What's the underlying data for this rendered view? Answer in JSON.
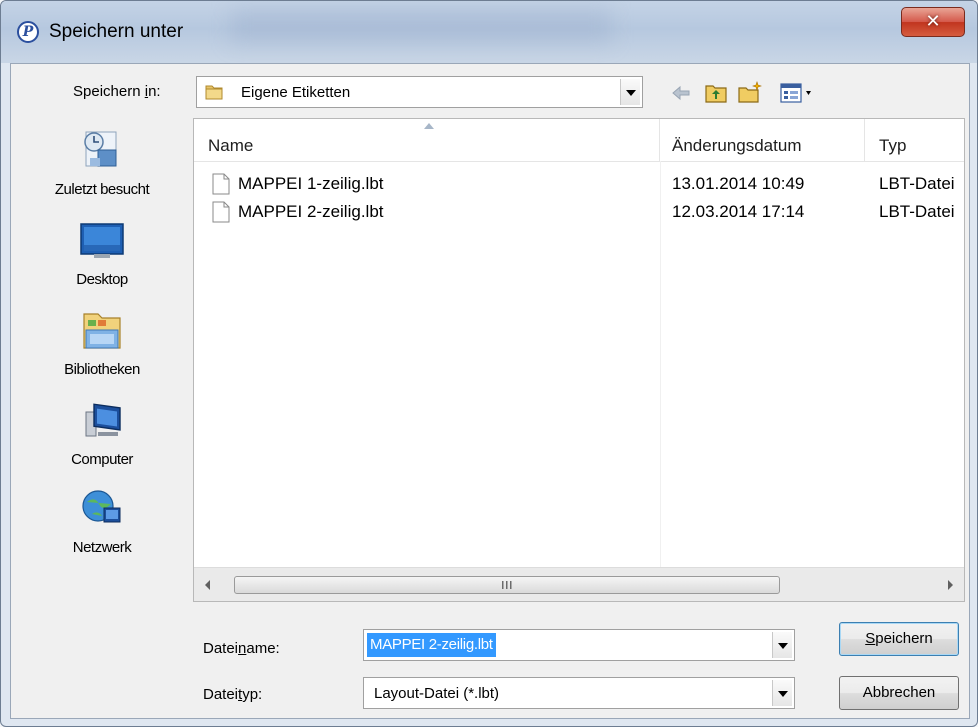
{
  "window": {
    "title": "Speichern unter"
  },
  "toolbar": {
    "save_in_label": "Speichern in:",
    "save_in_value": "Eigene Etiketten",
    "icons": [
      "back-arrow-icon",
      "up-folder-icon",
      "new-folder-icon",
      "views-menu-icon"
    ]
  },
  "places": [
    {
      "label": "Zuletzt besucht",
      "icon": "recent-places-icon"
    },
    {
      "label": "Desktop",
      "icon": "desktop-icon"
    },
    {
      "label": "Bibliotheken",
      "icon": "libraries-icon"
    },
    {
      "label": "Computer",
      "icon": "computer-icon"
    },
    {
      "label": "Netzwerk",
      "icon": "network-icon"
    }
  ],
  "columns": {
    "name": "Name",
    "date": "Änderungsdatum",
    "type": "Typ"
  },
  "files": [
    {
      "name": "MAPPEI 1-zeilig.lbt",
      "date": "13.01.2014 10:49",
      "type": "LBT-Datei"
    },
    {
      "name": "MAPPEI 2-zeilig.lbt",
      "date": "12.03.2014 17:14",
      "type": "LBT-Datei"
    }
  ],
  "scrollbar": {
    "grip": "III"
  },
  "form": {
    "filename_label": "Dateiname:",
    "filename_value": "MAPPEI 2-zeilig.lbt",
    "filetype_label": "Dateityp:",
    "filetype_value": "Layout-Datei (*.lbt)"
  },
  "buttons": {
    "save": "Speichern",
    "cancel": "Abbrechen"
  },
  "colors": {
    "selection": "#3399ff",
    "close_button": "#c7402b",
    "titlebar": "#b9cbe1"
  }
}
